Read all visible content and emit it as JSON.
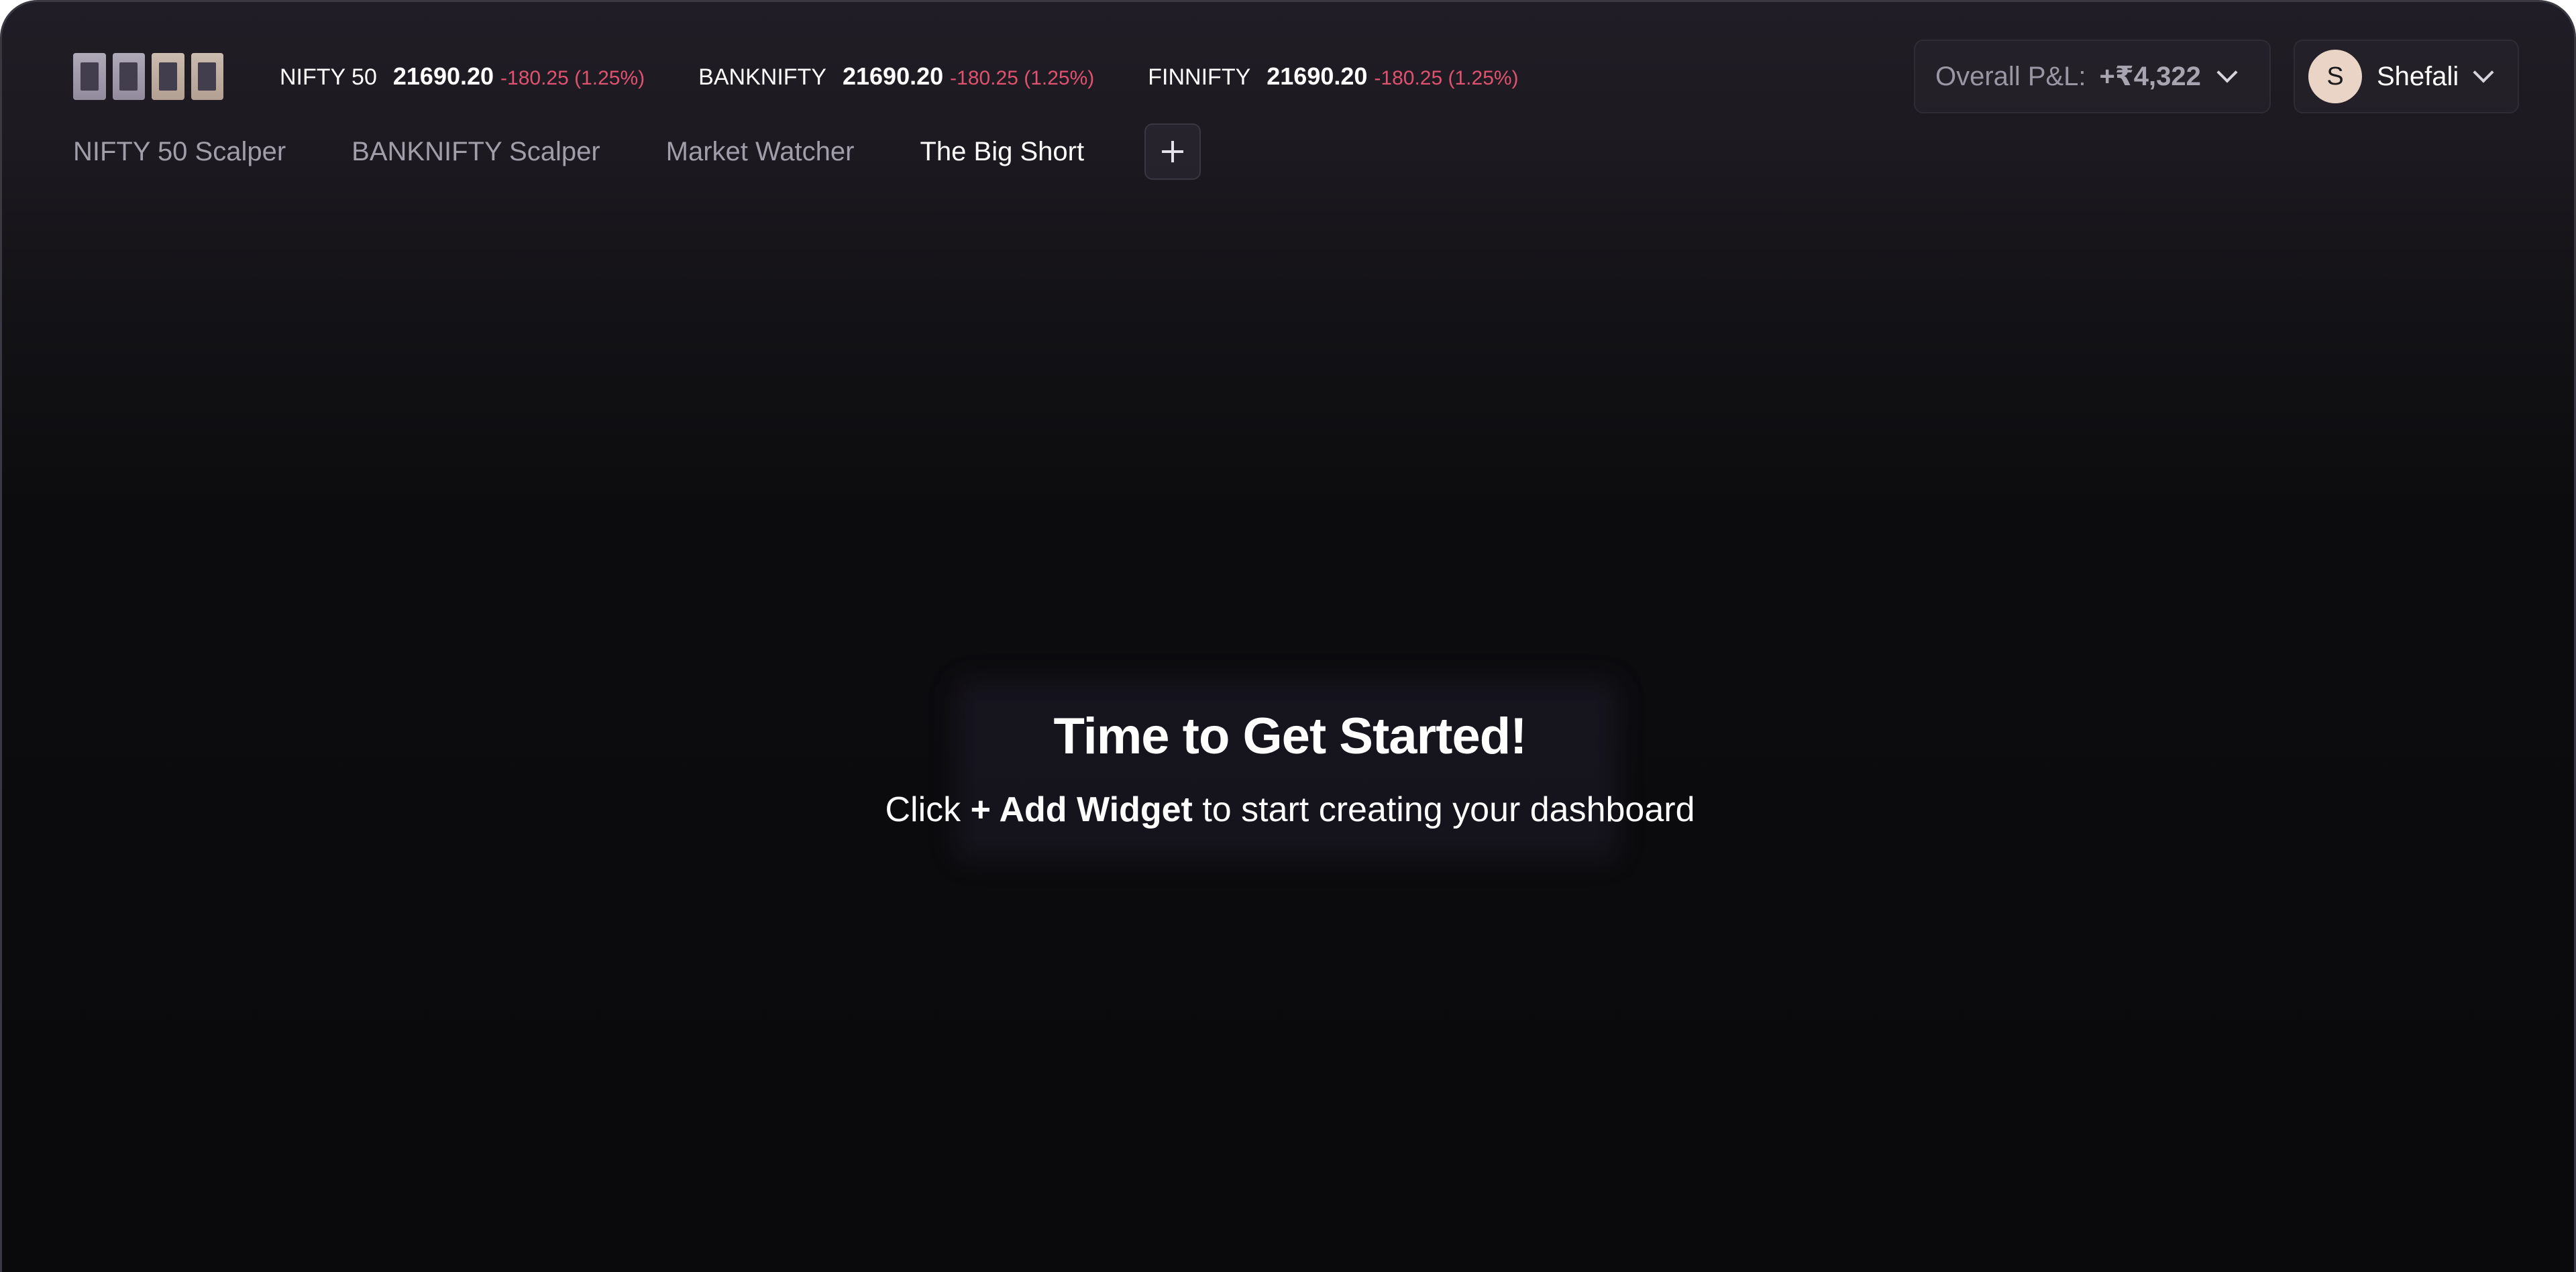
{
  "header": {
    "tickers": [
      {
        "name": "NIFTY 50",
        "price": "21690.20",
        "change": "-180.25 (1.25%)"
      },
      {
        "name": "BANKNIFTY",
        "price": "21690.20",
        "change": "-180.25 (1.25%)"
      },
      {
        "name": "FINNIFTY",
        "price": "21690.20",
        "change": "-180.25 (1.25%)"
      }
    ],
    "pnl": {
      "label": "Overall P&L:",
      "value": "+₹4,322"
    },
    "user": {
      "initial": "S",
      "name": "Shefali"
    }
  },
  "tabs": [
    {
      "label": "NIFTY 50 Scalper"
    },
    {
      "label": "BANKNIFTY Scalper"
    },
    {
      "label": "Market Watcher"
    },
    {
      "label": "The Big Short"
    }
  ],
  "empty_state": {
    "title": "Time to Get Started!",
    "prefix": "Click",
    "action": "+ Add Widget",
    "suffix": "to start creating your dashboard"
  },
  "colors": {
    "negative": "#e0526f",
    "avatar": "#ead4c6"
  }
}
